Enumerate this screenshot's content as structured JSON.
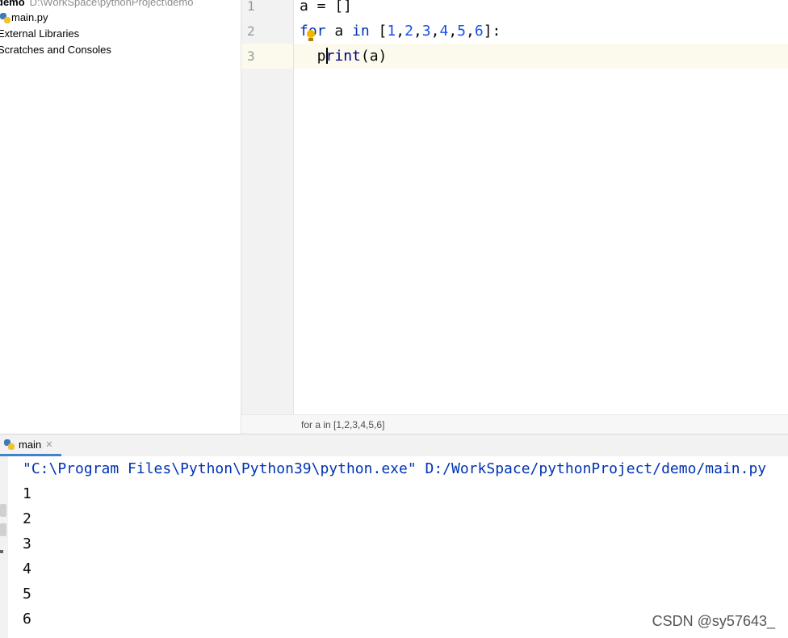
{
  "project_tree": {
    "root_name": "demo",
    "root_path": "D:\\WorkSpace\\pythonProject\\demo",
    "file": "main.py",
    "external_libraries": "External Libraries",
    "scratches": "Scratches and Consoles"
  },
  "editor": {
    "line_numbers": [
      "1",
      "2",
      "3"
    ],
    "breadcrumb": "for a in [1,2,3,4,5,6]"
  },
  "run_panel": {
    "tab_label": "main",
    "command": "\"C:\\Program Files\\Python\\Python39\\python.exe\" D:/WorkSpace/pythonProject/demo/main.py",
    "output": [
      "1",
      "2",
      "3",
      "4",
      "5",
      "6"
    ]
  },
  "watermark": "CSDN @sy57643_"
}
